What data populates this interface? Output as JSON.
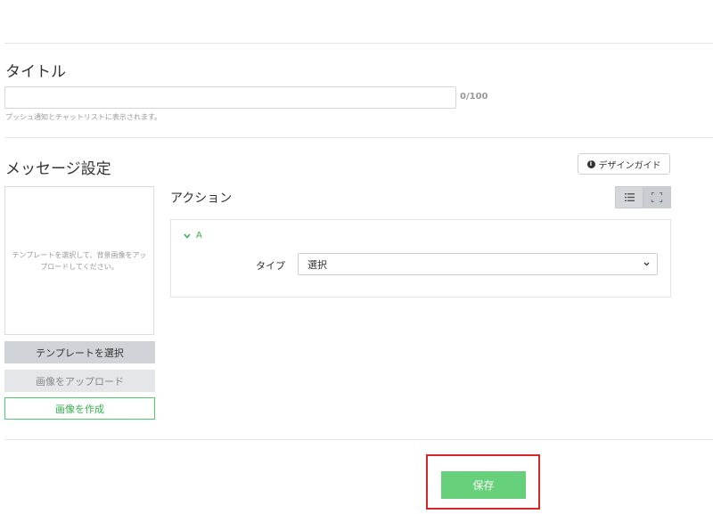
{
  "title_section": {
    "heading": "タイトル",
    "input_value": "",
    "counter": "0/100",
    "hint": "プッシュ通知とチャットリストに表示されます。"
  },
  "message_section": {
    "heading": "メッセージ設定",
    "design_guide_label": "デザインガイド",
    "preview_placeholder": "テンプレートを選択して、背景画像をアップロードしてください。",
    "select_template_label": "テンプレートを選択",
    "upload_image_label": "画像をアップロード",
    "create_image_label": "画像を作成"
  },
  "action_section": {
    "heading": "アクション",
    "action_name": "A",
    "type_label": "タイプ",
    "type_value": "選択"
  },
  "footer": {
    "save_label": "保存"
  },
  "icons": {
    "info": "info-icon",
    "list_view": "list-icon",
    "fullscreen": "fullscreen-icon",
    "chevron_down": "chevron-down-icon"
  },
  "colors": {
    "accent_green": "#35b14f",
    "save_button": "#66d07a",
    "highlight_frame": "#d7262a"
  }
}
